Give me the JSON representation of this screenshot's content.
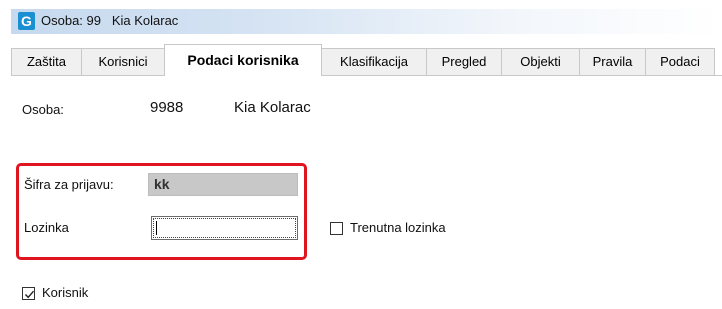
{
  "window": {
    "title": "Osoba: 99   Kia Kolarac",
    "icon_letter": "G"
  },
  "tabs": [
    {
      "label": "Zaštita",
      "active": false
    },
    {
      "label": "Korisnici",
      "active": false
    },
    {
      "label": "Podaci korisnika",
      "active": true
    },
    {
      "label": "Klasifikacija",
      "active": false
    },
    {
      "label": "Pregled",
      "active": false
    },
    {
      "label": "Objekti",
      "active": false
    },
    {
      "label": "Pravila",
      "active": false
    },
    {
      "label": "Podaci",
      "active": false
    }
  ],
  "person": {
    "label": "Osoba:",
    "id": "9988",
    "name": "Kia Kolarac"
  },
  "login": {
    "code_label": "Šifra za prijavu:",
    "code_value": "kk",
    "password_label": "Lozinka",
    "password_value": "",
    "current_password_label": "Trenutna lozinka",
    "current_password_checked": false
  },
  "user_checkbox": {
    "label": "Korisnik",
    "checked": true
  },
  "colors": {
    "highlight": "#e0141e",
    "readonly_bg": "#c8c8c8",
    "titlebar": "#c6d9ee"
  }
}
